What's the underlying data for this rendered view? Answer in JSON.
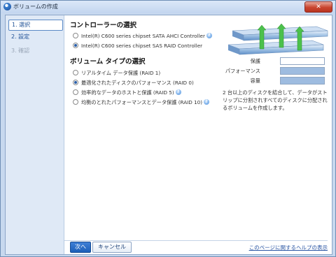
{
  "window": {
    "title": "ボリュームの作成",
    "close_label": "✕"
  },
  "steps": [
    {
      "label": "1. 選択"
    },
    {
      "label": "2. 設定"
    },
    {
      "label": "3. 確認"
    }
  ],
  "controller_section": {
    "heading": "コントローラーの選択",
    "options": [
      {
        "label": "Intel(R) C600 series chipset SATA AHCI Controller",
        "checked": false
      },
      {
        "label": "Intel(R) C600 series chipset SAS RAID Controller",
        "checked": true
      }
    ]
  },
  "volume_section": {
    "heading": "ボリューム タイプの選択",
    "options": [
      {
        "label": "リアルタイム データ保護 (RAID 1)",
        "checked": false
      },
      {
        "label": "最適化されたディスクのパフォーマンス (RAID 0)",
        "checked": true
      },
      {
        "label": "効率的なデータのホストと保護 (RAID 5)",
        "checked": false
      },
      {
        "label": "均衡のとれたパフォーマンスとデータ保護 (RAID 10)",
        "checked": false
      }
    ]
  },
  "meters": [
    {
      "label": "保護",
      "level": 0
    },
    {
      "label": "パフォーマンス",
      "level": 1
    },
    {
      "label": "容量",
      "level": 1
    }
  ],
  "description": "2 台以上のディスクを結合して、データがストリップに分割されすべてのディスクに分配されるボリュームを作成します。",
  "footer": {
    "next_label": "次へ",
    "cancel_label": "キャンセル",
    "help_link": "このページに関するヘルプの表示"
  },
  "colors": {
    "accent": "#1c5fb8",
    "meter_fill": "#9ebce0"
  }
}
